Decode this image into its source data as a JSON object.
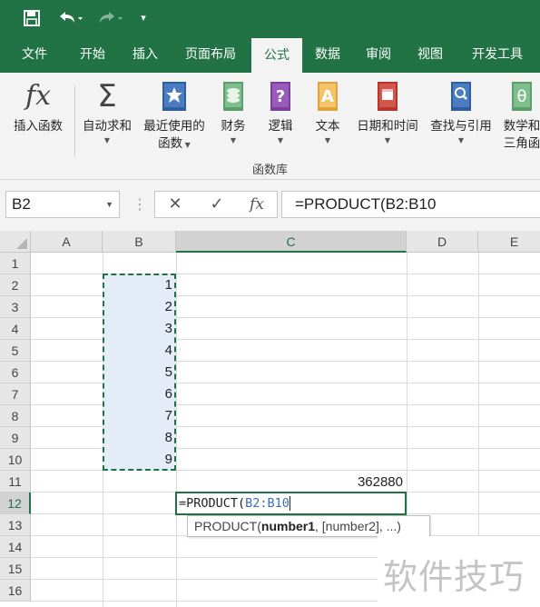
{
  "quick_access": {
    "customize_label": "▾"
  },
  "tabs": [
    {
      "label": "文件"
    },
    {
      "label": "开始"
    },
    {
      "label": "插入"
    },
    {
      "label": "页面布局"
    },
    {
      "label": "公式"
    },
    {
      "label": "数据"
    },
    {
      "label": "审阅"
    },
    {
      "label": "视图"
    },
    {
      "label": "开发工具"
    }
  ],
  "active_tab": "公式",
  "ribbon": {
    "insert_function": "插入函数",
    "autosum": "自动求和",
    "recent_line1": "最近使用的",
    "recent_line2": "函数",
    "financial": "财务",
    "logical": "逻辑",
    "text": "文本",
    "datetime": "日期和时间",
    "lookup": "查找与引用",
    "math_line1": "数学和",
    "math_line2": "三角函",
    "group_label": "函数库"
  },
  "formula_bar": {
    "name_box": "B2",
    "cancel_glyph": "✕",
    "enter_glyph": "✓",
    "fx_glyph": "fx",
    "formula": "=PRODUCT(B2:B10"
  },
  "grid": {
    "columns": [
      "A",
      "B",
      "C",
      "D",
      "E"
    ],
    "rows": [
      "1",
      "2",
      "3",
      "4",
      "5",
      "6",
      "7",
      "8",
      "9",
      "10",
      "11",
      "12",
      "13",
      "14",
      "15",
      "16"
    ],
    "b_values": [
      "1",
      "2",
      "3",
      "4",
      "5",
      "6",
      "7",
      "8",
      "9"
    ],
    "c11_value": "362880",
    "c12_prefix": "=PRODUCT(",
    "c12_ref": "B2:B10",
    "tooltip_func": "PRODUCT(",
    "tooltip_arg1": "number1",
    "tooltip_rest": ", [number2], ...)"
  },
  "watermark": "软件技巧",
  "colors": {
    "accent": "#217346",
    "selection_fill": "#e3ecf7",
    "ref_blue": "#3a6fb5"
  }
}
